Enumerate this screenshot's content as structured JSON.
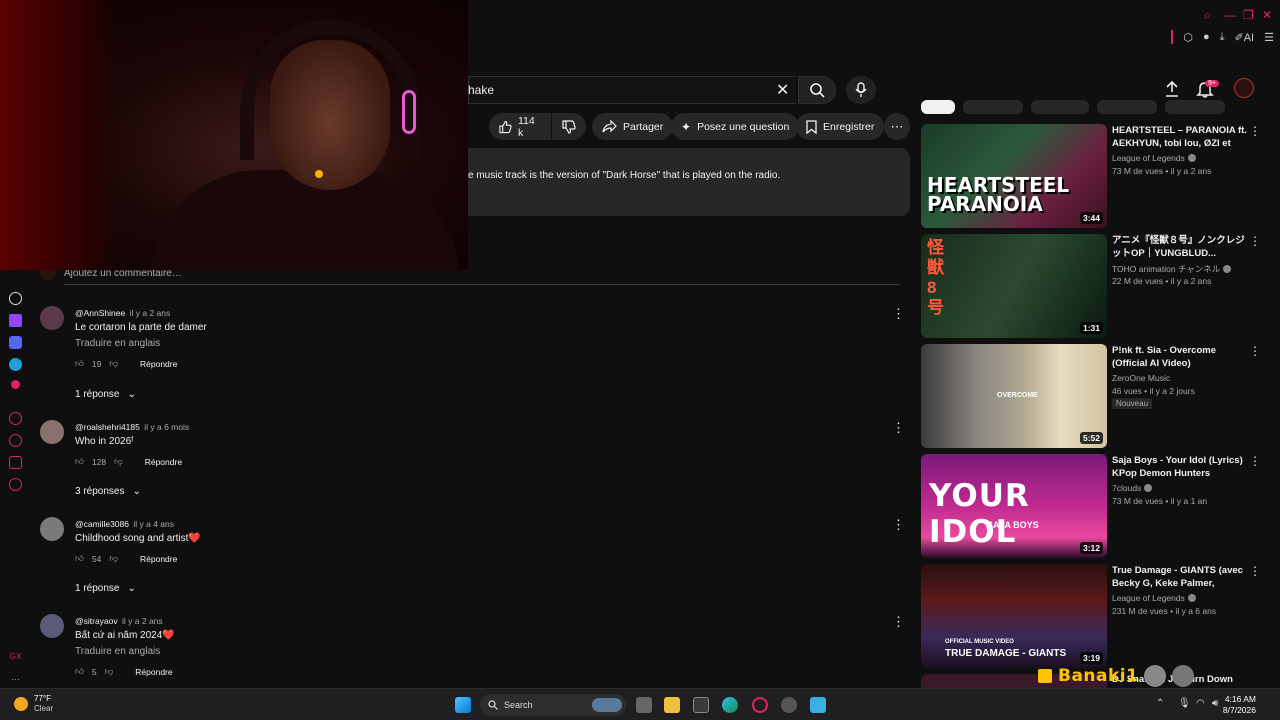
{
  "search": {
    "query": "hake"
  },
  "actions": {
    "likes": "114 k",
    "share": "Partager",
    "ask": "Posez une question",
    "save": "Enregistrer"
  },
  "description": {
    "text": "e music track is the version of \"Dark Horse\" that is played on the radio."
  },
  "notifications": {
    "count": "9+"
  },
  "comments_section": {
    "add_placeholder": "Ajoutez un commentaire…"
  },
  "comments": [
    {
      "author": "@AnnShinee",
      "time": "il y a 2 ans",
      "text": "Le cortaron la parte de damer",
      "translate": "Traduire en anglais",
      "likes": "19",
      "reply": "Répondre",
      "replies": "1 réponse"
    },
    {
      "author": "@roalshehri4185",
      "time": "il y a 6 mois",
      "text": "Who in 2026ᶠ",
      "likes": "128",
      "reply": "Répondre",
      "replies": "3 réponses"
    },
    {
      "author": "@camille3086",
      "time": "il y a 4 ans",
      "text": "Childhood song and artist❤️",
      "likes": "54",
      "reply": "Répondre",
      "replies": "1 réponse"
    },
    {
      "author": "@sitrayaov",
      "time": "il y a 2 ans",
      "text": "Bất cứ ai năm 2024❤️",
      "translate": "Traduire en anglais",
      "likes": "5",
      "reply": "Répondre"
    }
  ],
  "recommendations": [
    {
      "title": "HEARTSTEEL – PARANOIA ft. AEKHYUN, tobi lou, ØZI et Cal...",
      "channel": "League of Legends",
      "views": "73 M de vues • il y a 2 ans",
      "duration": "3:44",
      "thumb_text": "HEARTSTEEL PARANOIA"
    },
    {
      "title": "アニメ『怪獣８号』ノンクレジットOP｜YUNGBLUD...",
      "channel": "TOHO animation チャンネル",
      "views": "22 M de vues • il y a 2 ans",
      "duration": "1:31",
      "thumb_text": "怪獣8号"
    },
    {
      "title": "P!nk ft. Sia - Overcome (Official AI Video)",
      "channel": "ZeroOne Music",
      "views": "46 vues • il y a 2 jours",
      "badge": "Nouveau",
      "duration": "5:52",
      "thumb_text": "OVERCOME"
    },
    {
      "title": "Saja Boys - Your Idol (Lyrics) KPop Demon Hunters",
      "channel": "7clouds",
      "views": "73 M de vues • il y a 1 an",
      "duration": "3:12",
      "thumb_text": "YOUR IDOL",
      "thumb_sub": "SAJA BOYS"
    },
    {
      "title": "True Damage - GIANTS (avec Becky G, Keke Palmer, SOYEO...",
      "channel": "League of Legends",
      "views": "231 M de vues • il y a 6 ans",
      "duration": "3:19",
      "thumb_text": "TRUE DAMAGE - GIANTS",
      "thumb_sub": "OFFICIAL MUSIC VIDEO"
    }
  ],
  "partial_rec": {
    "title": "DJ Snake ... Je... urn Down"
  },
  "stream_overlay": {
    "name": "Banaki1"
  },
  "taskbar": {
    "weather_temp": "77°F",
    "weather_desc": "Clear",
    "search_label": "Search",
    "time": "4:16 AM",
    "date": "8/7/2026"
  },
  "colors": {
    "accent": "#e0245e",
    "background": "#0f0f0f",
    "pill": "#272727"
  }
}
